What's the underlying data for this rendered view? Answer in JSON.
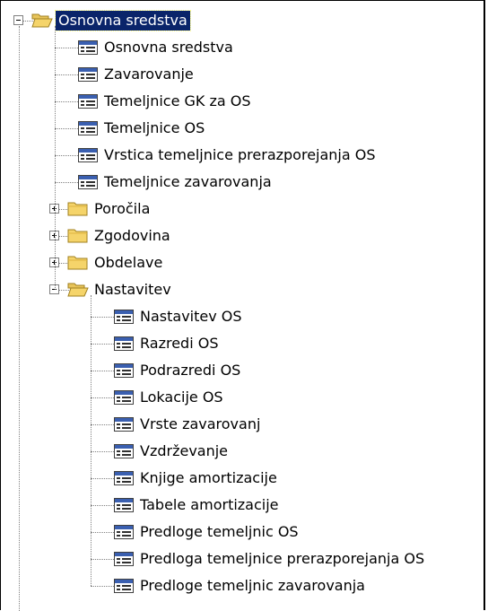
{
  "tree": {
    "root": {
      "label": "Osnovna sredstva",
      "icon": "open-folder-icon",
      "expanded": true,
      "selected": true
    },
    "items": [
      {
        "label": "Osnovna sredstva",
        "icon": "table-icon"
      },
      {
        "label": "Zavarovanje",
        "icon": "table-icon"
      },
      {
        "label": "Temeljnice GK za OS",
        "icon": "table-icon"
      },
      {
        "label": "Temeljnice OS",
        "icon": "table-icon"
      },
      {
        "label": "Vrstica temeljnice prerazporejanja OS",
        "icon": "table-icon"
      },
      {
        "label": "Temeljnice zavarovanja",
        "icon": "table-icon"
      }
    ],
    "folders": [
      {
        "label": "Poročila",
        "icon": "folder-icon",
        "expanded": false
      },
      {
        "label": "Zgodovina",
        "icon": "folder-icon",
        "expanded": false
      },
      {
        "label": "Obdelave",
        "icon": "folder-icon",
        "expanded": false
      },
      {
        "label": "Nastavitev",
        "icon": "open-folder-icon",
        "expanded": true
      }
    ],
    "setup_items": [
      {
        "label": "Nastavitev OS",
        "icon": "table-icon"
      },
      {
        "label": "Razredi OS",
        "icon": "table-icon"
      },
      {
        "label": "Podrazredi OS",
        "icon": "table-icon"
      },
      {
        "label": "Lokacije OS",
        "icon": "table-icon"
      },
      {
        "label": "Vrste zavarovanj",
        "icon": "table-icon"
      },
      {
        "label": "Vzdrževanje",
        "icon": "table-icon"
      },
      {
        "label": "Knjige amortizacije",
        "icon": "table-icon"
      },
      {
        "label": "Tabele amortizacije",
        "icon": "table-icon"
      },
      {
        "label": "Predloge temeljnic OS",
        "icon": "table-icon"
      },
      {
        "label": "Predloga temeljnice prerazporejanja OS",
        "icon": "table-icon"
      },
      {
        "label": "Predloge temeljnic zavarovanja",
        "icon": "table-icon"
      }
    ]
  },
  "colors": {
    "selection_bg": "#0a246a",
    "selection_text": "#ffffff",
    "folder_yellow": "#f5d46a",
    "table_icon_blue": "#3a5fb0"
  }
}
